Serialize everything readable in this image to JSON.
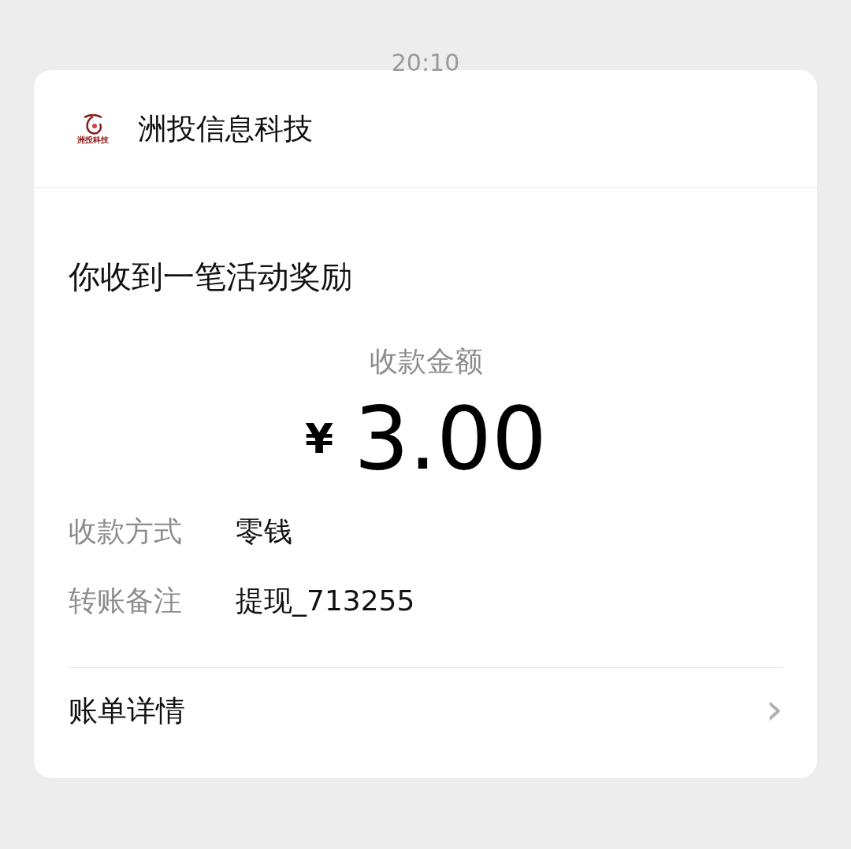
{
  "time": "20:10",
  "merchant": {
    "logo_text": "洲投科技",
    "name": "洲投信息科技"
  },
  "message": {
    "title": "你收到一笔活动奖励",
    "amount_label": "收款金额",
    "currency": "¥",
    "amount": "3.00",
    "details": [
      {
        "label": "收款方式",
        "value": "零钱"
      },
      {
        "label": "转账备注",
        "value": "提现_713255"
      }
    ]
  },
  "footer": {
    "label": "账单详情",
    "chevron": "›"
  }
}
